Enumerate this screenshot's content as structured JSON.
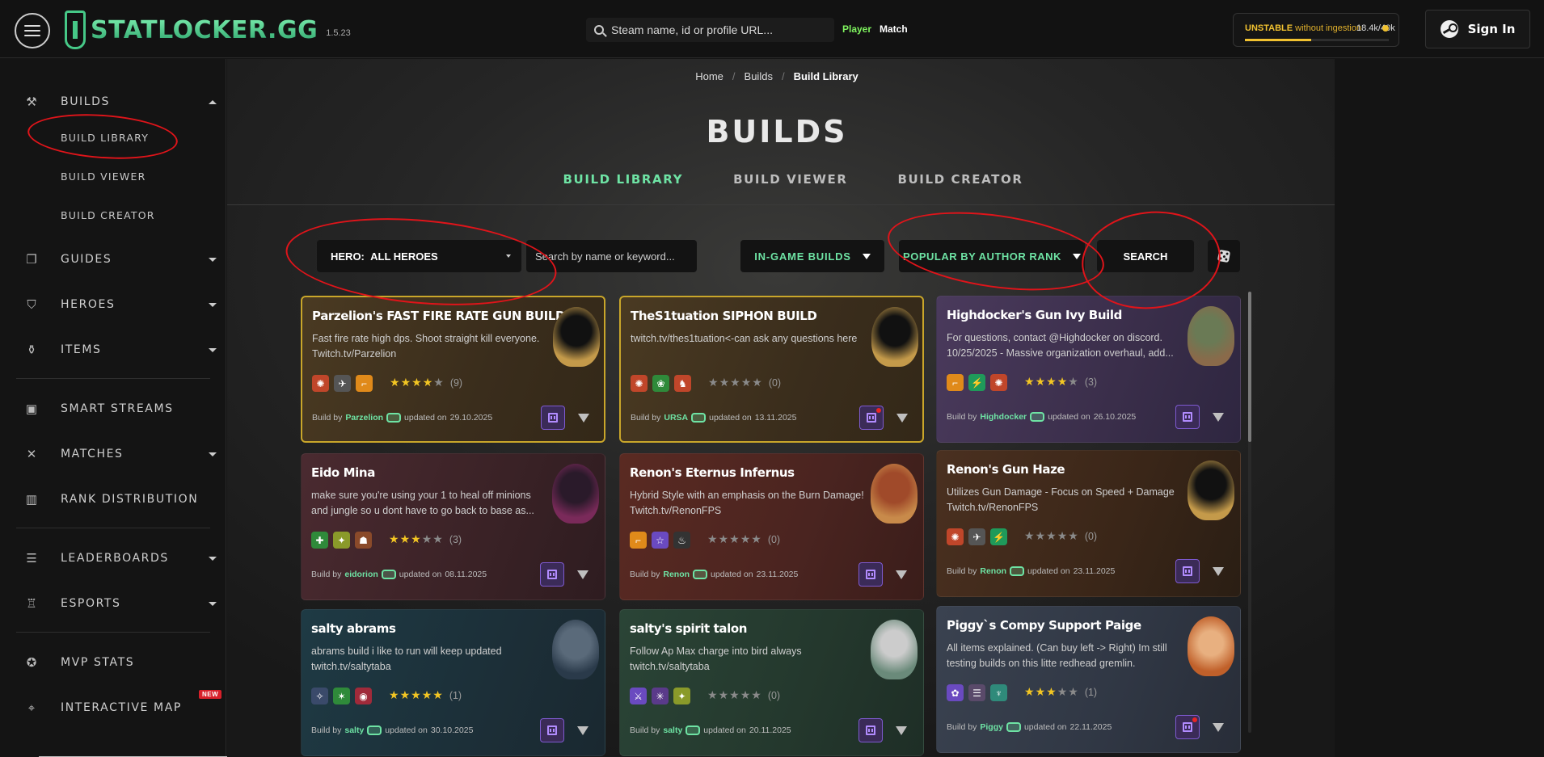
{
  "app": {
    "logo_text": "STATLOCKER.GG",
    "version": "1.5.23",
    "search_placeholder": "Steam name, id or profile URL...",
    "mode_player": "Player",
    "mode_match": "Match",
    "status": {
      "label": "UNSTABLE",
      "detail": "without ingestion",
      "count": "18.4k/40k",
      "progress": 0.46,
      "color": "#f2c230"
    },
    "signin_label": "Sign In"
  },
  "sidebar": {
    "builds": {
      "label": "BUILDS",
      "sub": [
        "BUILD LIBRARY",
        "BUILD VIEWER",
        "BUILD CREATOR"
      ]
    },
    "items": [
      {
        "label": "GUIDES",
        "icon": "book-icon"
      },
      {
        "label": "HEROES",
        "icon": "shield-icon"
      },
      {
        "label": "ITEMS",
        "icon": "item-icon"
      },
      {
        "label": "SMART STREAMS",
        "icon": "stream-icon"
      },
      {
        "label": "MATCHES",
        "icon": "swords-icon"
      },
      {
        "label": "RANK DISTRIBUTION",
        "icon": "bar-chart-icon"
      },
      {
        "label": "LEADERBOARDS",
        "icon": "leaderboard-icon"
      },
      {
        "label": "ESPORTS",
        "icon": "trophy-icon"
      },
      {
        "label": "MVP STATS",
        "icon": "medal-icon"
      },
      {
        "label": "INTERACTIVE MAP",
        "icon": "map-icon",
        "badge": "NEW"
      }
    ]
  },
  "main": {
    "breadcrumb": [
      "Home",
      "Builds",
      "Build Library"
    ],
    "title": "BUILDS",
    "tabs": [
      "BUILD LIBRARY",
      "BUILD VIEWER",
      "BUILD CREATOR"
    ],
    "filters": {
      "hero_label": "HERO:",
      "hero_value": "ALL HEROES",
      "search_placeholder": "Search by name or keyword...",
      "ingame": "IN-GAME BUILDS",
      "sort": "POPULAR BY AUTHOR RANK",
      "search_button": "SEARCH"
    },
    "build_by": "Build by",
    "updated_on": "updated on",
    "cards": [
      {
        "title": "Parzelion's FAST FIRE RATE GUN BUILD",
        "desc": "Fast fire rate high dps. Shoot straight kill everyone. Twitch.tv/Parzelion",
        "rating": 4,
        "count": "(9)",
        "author": "Parzelion",
        "date": "29.10.2025",
        "featured": true,
        "live": false
      },
      {
        "title": "TheS1tuation SIPHON BUILD",
        "desc": "twitch.tv/thes1tuation<-can ask any questions here",
        "rating": 0,
        "count": "(0)",
        "author": "URSA",
        "date": "13.11.2025",
        "featured": true,
        "live": true
      },
      {
        "title": "Highdocker's Gun Ivy Build",
        "desc": "For questions, contact @Highdocker on discord. 10/25/2025 - Massive organization overhaul, add...",
        "rating": 4,
        "count": "(3)",
        "author": "Highdocker",
        "date": "26.10.2025",
        "featured": false,
        "live": false
      },
      {
        "title": "Eido Mina",
        "desc": "make sure you're using your 1 to heal off minions and jungle so u dont have to go back to base as...",
        "rating": 3,
        "count": "(3)",
        "author": "eidorion",
        "date": "08.11.2025",
        "featured": false,
        "live": false
      },
      {
        "title": "Renon's Eternus Infernus",
        "desc": "Hybrid Style with an emphasis on the Burn Damage! Twitch.tv/RenonFPS",
        "rating": 0,
        "count": "(0)",
        "author": "Renon",
        "date": "23.11.2025",
        "featured": false,
        "live": false
      },
      {
        "title": "Renon's Gun Haze",
        "desc": "Utilizes Gun Damage - Focus on Speed + Damage Twitch.tv/RenonFPS",
        "rating": 0,
        "count": "(0)",
        "author": "Renon",
        "date": "23.11.2025",
        "featured": false,
        "live": false
      },
      {
        "title": "salty abrams",
        "desc": "abrams build i like to run will keep updated twitch.tv/saltytaba",
        "rating": 5,
        "count": "(1)",
        "author": "salty",
        "date": "30.10.2025",
        "featured": false,
        "live": false
      },
      {
        "title": "salty's spirit talon",
        "desc": "Follow Ap Max charge into bird always twitch.tv/saltytaba",
        "rating": 0,
        "count": "(0)",
        "author": "salty",
        "date": "20.11.2025",
        "featured": false,
        "live": false
      },
      {
        "title": "Piggy`s Compy Support Paige",
        "desc": "All items explained. (Can buy left -> Right) Im still testing builds on this litte redhead gremlin.",
        "rating": 3,
        "count": "(1)",
        "author": "Piggy",
        "date": "22.11.2025",
        "featured": false,
        "live": true
      }
    ]
  }
}
